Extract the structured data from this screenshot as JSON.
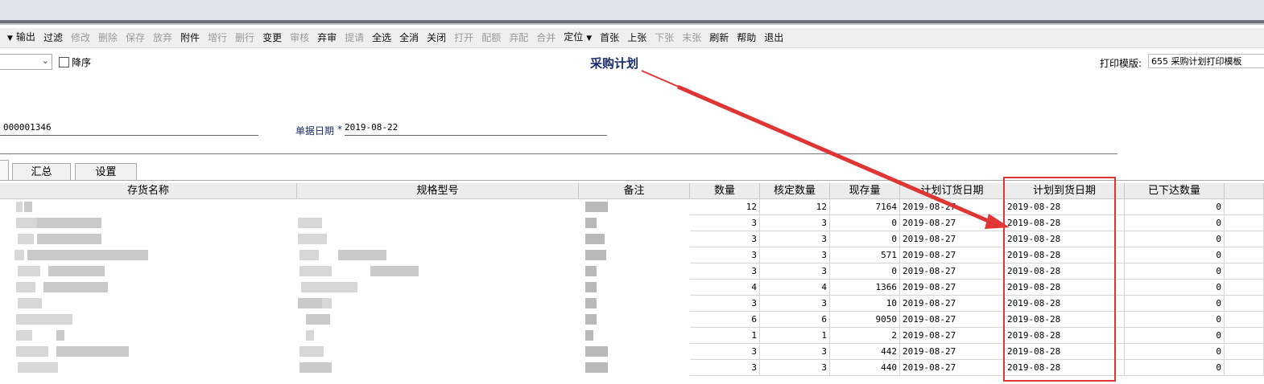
{
  "toolbar": {
    "items": [
      {
        "label": "输出",
        "disabled": false,
        "caret_before": true
      },
      {
        "label": "过滤",
        "disabled": false
      },
      {
        "label": "修改",
        "disabled": true
      },
      {
        "label": "删除",
        "disabled": true
      },
      {
        "label": "保存",
        "disabled": true
      },
      {
        "label": "放弃",
        "disabled": true
      },
      {
        "label": "附件",
        "disabled": false
      },
      {
        "label": "增行",
        "disabled": true
      },
      {
        "label": "删行",
        "disabled": true
      },
      {
        "label": "变更",
        "disabled": false
      },
      {
        "label": "审核",
        "disabled": true
      },
      {
        "label": "弃审",
        "disabled": false
      },
      {
        "label": "提请",
        "disabled": true
      },
      {
        "label": "全选",
        "disabled": false
      },
      {
        "label": "全消",
        "disabled": false
      },
      {
        "label": "关闭",
        "disabled": false
      },
      {
        "label": "打开",
        "disabled": true
      },
      {
        "label": "配额",
        "disabled": true
      },
      {
        "label": "弃配",
        "disabled": true
      },
      {
        "label": "合并",
        "disabled": true
      },
      {
        "label": "定位",
        "disabled": false,
        "caret_after": true
      },
      {
        "label": "首张",
        "disabled": false
      },
      {
        "label": "上张",
        "disabled": false
      },
      {
        "label": "下张",
        "disabled": true
      },
      {
        "label": "末张",
        "disabled": true
      },
      {
        "label": "刷新",
        "disabled": false
      },
      {
        "label": "帮助",
        "disabled": false
      },
      {
        "label": "退出",
        "disabled": false
      }
    ]
  },
  "header": {
    "descending_label": "降序",
    "title": "采购计划",
    "print_template_label": "打印模版:",
    "print_template_value": "655 采购计划打印模板",
    "doc_number": "000001346",
    "date_label": "单据日期",
    "date_required_mark": "*",
    "date_value": "2019-08-22"
  },
  "tabs": [
    "汇总",
    "设置"
  ],
  "grid": {
    "columns": [
      "存货名称",
      "规格型号",
      "备注",
      "数量",
      "核定数量",
      "现存量",
      "计划订货日期",
      "计划到货日期",
      "已下达数量"
    ],
    "rows": [
      {
        "qty": "12",
        "approved": "12",
        "stock": "7164",
        "order_date": "2019-08-27",
        "arrival_date": "2019-08-28",
        "issued": "0"
      },
      {
        "qty": "3",
        "approved": "3",
        "stock": "0",
        "order_date": "2019-08-27",
        "arrival_date": "2019-08-28",
        "issued": "0"
      },
      {
        "qty": "3",
        "approved": "3",
        "stock": "0",
        "order_date": "2019-08-27",
        "arrival_date": "2019-08-28",
        "issued": "0"
      },
      {
        "qty": "3",
        "approved": "3",
        "stock": "571",
        "order_date": "2019-08-27",
        "arrival_date": "2019-08-28",
        "issued": "0"
      },
      {
        "qty": "3",
        "approved": "3",
        "stock": "0",
        "order_date": "2019-08-27",
        "arrival_date": "2019-08-28",
        "issued": "0"
      },
      {
        "qty": "4",
        "approved": "4",
        "stock": "1366",
        "order_date": "2019-08-27",
        "arrival_date": "2019-08-28",
        "issued": "0"
      },
      {
        "qty": "3",
        "approved": "3",
        "stock": "10",
        "order_date": "2019-08-27",
        "arrival_date": "2019-08-28",
        "issued": "0"
      },
      {
        "qty": "6",
        "approved": "6",
        "stock": "9050",
        "order_date": "2019-08-27",
        "arrival_date": "2019-08-28",
        "issued": "0"
      },
      {
        "qty": "1",
        "approved": "1",
        "stock": "2",
        "order_date": "2019-08-27",
        "arrival_date": "2019-08-28",
        "issued": "0"
      },
      {
        "qty": "3",
        "approved": "3",
        "stock": "442",
        "order_date": "2019-08-27",
        "arrival_date": "2019-08-28",
        "issued": "0"
      },
      {
        "qty": "3",
        "approved": "3",
        "stock": "440",
        "order_date": "2019-08-27",
        "arrival_date": "2019-08-28",
        "issued": "0"
      }
    ]
  },
  "colors": {
    "annotation_red": "#e03535",
    "title_navy": "#1a2d6b"
  }
}
